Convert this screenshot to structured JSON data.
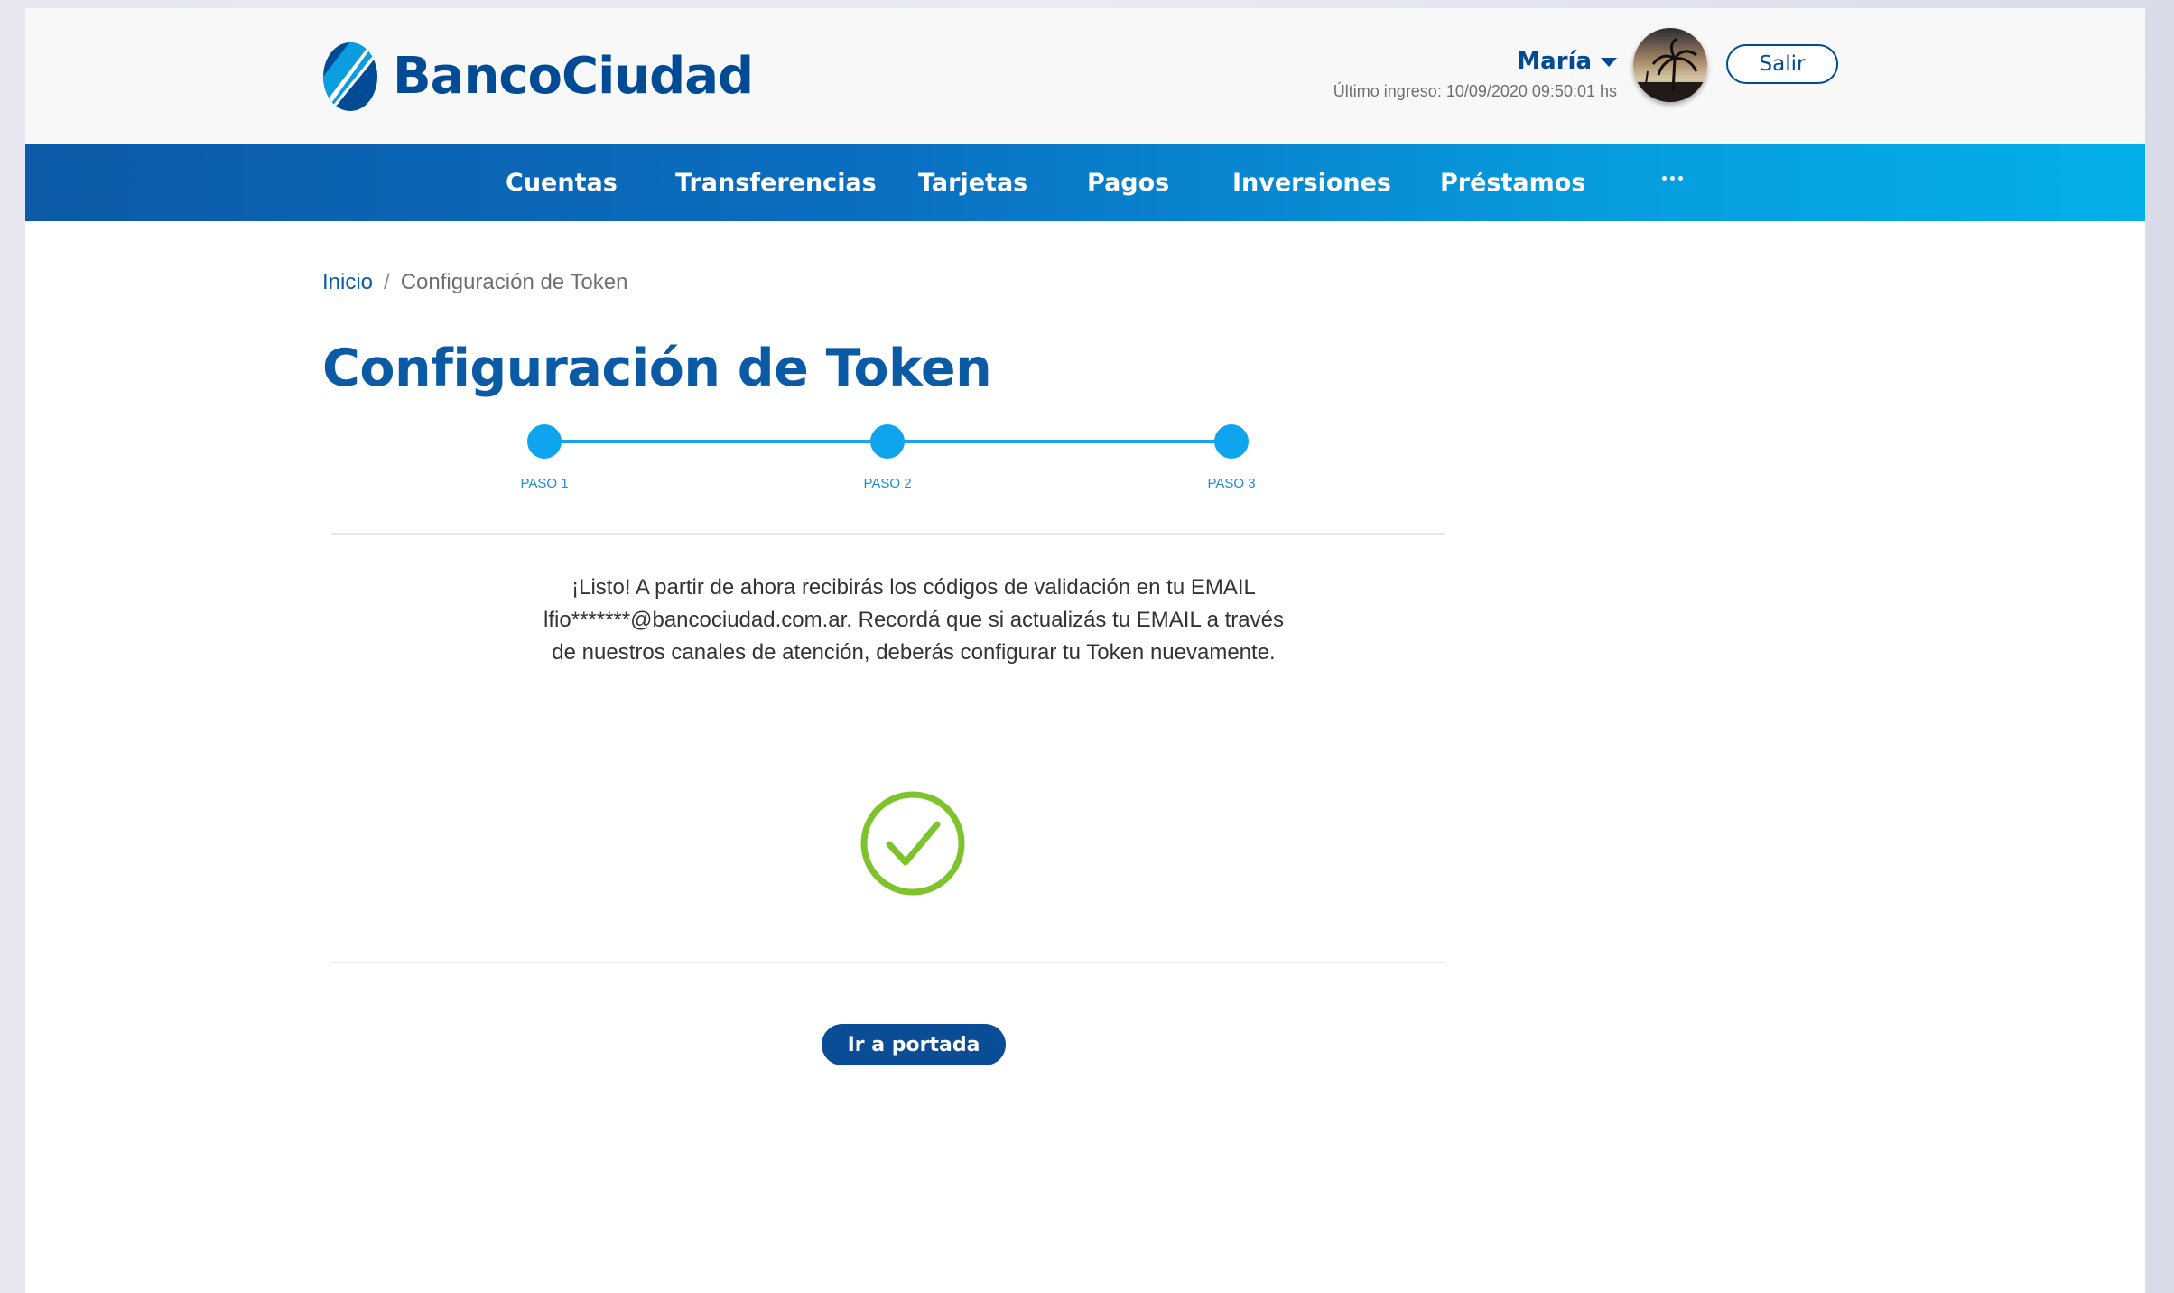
{
  "brand": {
    "name": "BancoCiudad",
    "color": "#004b93"
  },
  "user": {
    "name": "María",
    "last_login": "Último ingreso: 10/09/2020 09:50:01 hs",
    "logout_label": "Salir"
  },
  "nav": {
    "items": [
      "Cuentas",
      "Transferencias",
      "Tarjetas",
      "Pagos",
      "Inversiones",
      "Préstamos"
    ],
    "more_icon": "more-horizontal-icon"
  },
  "breadcrumb": {
    "home": "Inicio",
    "separator": "/",
    "current": "Configuración de Token"
  },
  "page_title": "Configuración de Token",
  "stepper": {
    "steps": [
      "PASO 1",
      "PASO 2",
      "PASO 3"
    ],
    "current_step": 3,
    "color": "#0ea5ee"
  },
  "message": "¡Listo! A partir de ahora recibirás los códigos de validación en tu EMAIL lfio*******@bancociudad.com.ar. Recordá que si actualizás tu EMAIL a través de nuestros canales de atención, deberás configurar tu Token nuevamente.",
  "success_icon": "check-circle-icon",
  "success_color": "#7dc42c",
  "actions": {
    "home_button": "Ir a portada"
  }
}
